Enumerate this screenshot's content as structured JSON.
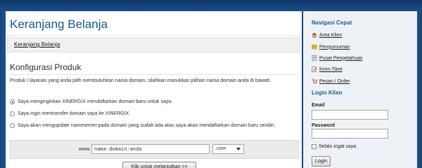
{
  "main": {
    "title": "Keranjang Belanja",
    "breadcrumb": "Keranjang Belanja",
    "section_title": "Konfigurasi Produk",
    "intro": "Produk / layanan yang anda pilih membutuhkan nama domain, silahkan masukkan pilihan nama domain anda di bawah.",
    "options": [
      {
        "label": "Saya menginginkan XINERGIX mendaftarkan domain baru untuk saya.",
        "checked": true
      },
      {
        "label": "Saya ingin mentransfer domain saya ke XINERGIX",
        "checked": false
      },
      {
        "label": "Saya akan mengupdate nameserver pada domain yang sudah ada atau saya akan mendaftarkan domain baru sendiri.",
        "checked": false
      }
    ],
    "domain": {
      "prefix": "www.",
      "value": "nama-domain-anda",
      "tld_selected": ".com"
    },
    "continue_label": "Klik untuk melanjutkan >>"
  },
  "sidebar": {
    "nav_title": "Navigasi Cepat",
    "nav_items": [
      {
        "label": "Area Klien",
        "icon": "home-icon"
      },
      {
        "label": "Pengumuman",
        "icon": "announcement-icon"
      },
      {
        "label": "Pusat Pengetahuan",
        "icon": "knowledgebase-icon"
      },
      {
        "label": "Kirim Tiket",
        "icon": "ticket-icon"
      },
      {
        "label": "Pesan / Order",
        "icon": "order-icon"
      }
    ],
    "login_title": "Login Klien",
    "email_label": "Email",
    "password_label": "Password",
    "remember_label": "Selalu ingat saya",
    "login_button": "Login"
  },
  "colors": {
    "accent": "#1a5d99",
    "background": "#1d5493"
  }
}
